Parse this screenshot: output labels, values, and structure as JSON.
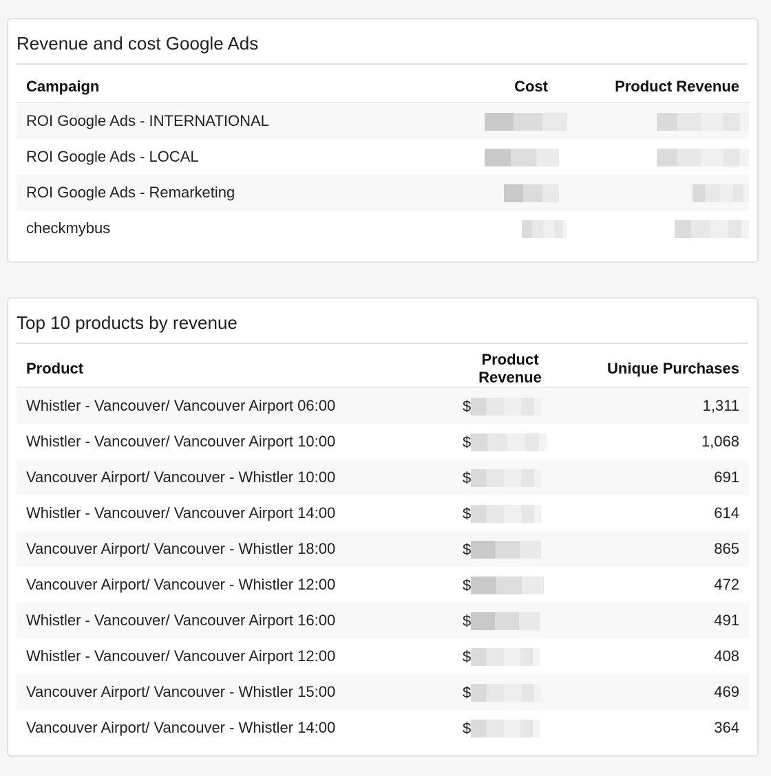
{
  "campaigns_card": {
    "title": "Revenue and cost Google Ads",
    "headers": {
      "campaign": "Campaign",
      "cost": "Cost",
      "revenue": "Product Revenue"
    },
    "rows": [
      {
        "campaign": "ROI Google Ads - INTERNATIONAL"
      },
      {
        "campaign": "ROI Google Ads - LOCAL"
      },
      {
        "campaign": "ROI Google Ads - Remarketing"
      },
      {
        "campaign": "checkmybus"
      }
    ]
  },
  "products_card": {
    "title": "Top 10 products by revenue",
    "headers": {
      "product": "Product",
      "revenue": "Product Revenue",
      "purchases": "Unique Purchases"
    },
    "currency_symbol": "$",
    "rows": [
      {
        "product": "Whistler - Vancouver/ Vancouver Airport 06:00",
        "purchases": "1,311"
      },
      {
        "product": "Whistler - Vancouver/ Vancouver Airport 10:00",
        "purchases": "1,068"
      },
      {
        "product": "Vancouver Airport/ Vancouver - Whistler 10:00",
        "purchases": "691"
      },
      {
        "product": "Whistler - Vancouver/ Vancouver Airport 14:00",
        "purchases": "614"
      },
      {
        "product": "Vancouver Airport/ Vancouver - Whistler 18:00",
        "purchases": "865"
      },
      {
        "product": "Vancouver Airport/ Vancouver - Whistler 12:00",
        "purchases": "472"
      },
      {
        "product": "Whistler - Vancouver/ Vancouver Airport 16:00",
        "purchases": "491"
      },
      {
        "product": "Whistler - Vancouver/ Vancouver Airport 12:00",
        "purchases": "408"
      },
      {
        "product": "Vancouver Airport/ Vancouver - Whistler 15:00",
        "purchases": "469"
      },
      {
        "product": "Vancouver Airport/ Vancouver - Whistler 14:00",
        "purchases": "364"
      }
    ]
  }
}
